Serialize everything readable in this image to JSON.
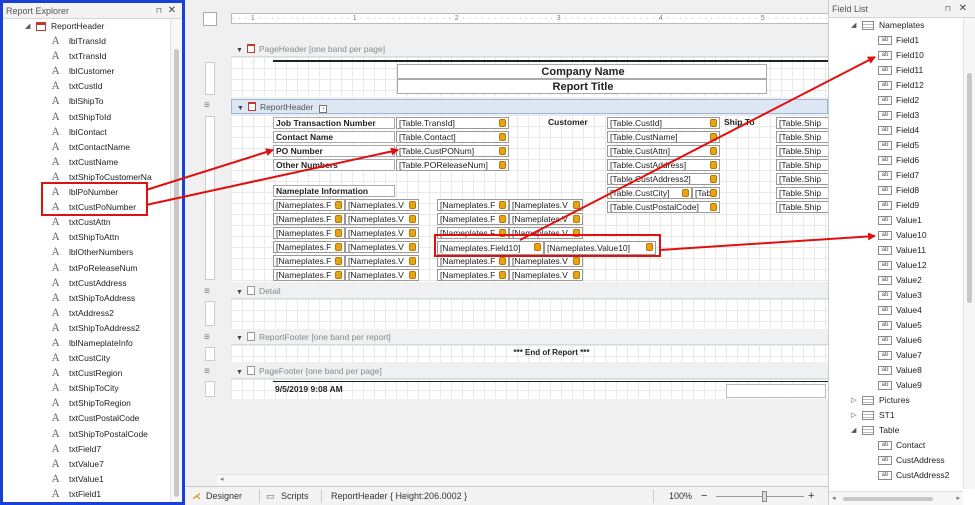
{
  "explorer": {
    "title": "Report Explorer",
    "root_label": "ReportHeader",
    "items": [
      "lblTransId",
      "txtTransId",
      "lblCustomer",
      "txtCustId",
      "lblShipTo",
      "txtShipToId",
      "lblContact",
      "txtContactName",
      "txtCustName",
      "txtShipToCustomerNa",
      "lblPoNumber",
      "txtCustPoNumber",
      "txtCustAttn",
      "txtShipToAttn",
      "lblOtherNumbers",
      "txtPoReleaseNum",
      "txtCustAddress",
      "txtShipToAddress",
      "txtAddress2",
      "txtShipToAddress2",
      "lblNameplateInfo",
      "txtCustCity",
      "txtCustRegion",
      "txtShipToCity",
      "txtShipToRegion",
      "txtCustPostalCode",
      "txtShipToPostalCode",
      "txtField7",
      "txtValue7",
      "txtValue1",
      "txtField1"
    ]
  },
  "designer": {
    "ruler": "· · · 1 · · · · · · · · · · · · · · · 1 · · · · · · · · · · · · · · · 2 · · · · · · · · · · · · · · · 3 · · · · · · · · · · · · · · · 4 · · · · · · · · · · · · · · · 5 · · · · · · · · · · · · · · · 6 · · · · · · · · · · 1",
    "bands": {
      "page_header": "PageHeader [one band per page]",
      "report_header": "ReportHeader",
      "detail": "Detail",
      "report_footer": "ReportFooter [one band per report]",
      "page_footer": "PageFooter [one band per page]"
    },
    "company_name": "Company Name",
    "report_title": "Report Title",
    "labels": {
      "job": "Job Transaction Number",
      "contact": "Contact Name",
      "po": "PO Number",
      "other": "Other Numbers",
      "customer": "Customer",
      "ship_to": "Ship To",
      "nameplate": "Nameplate Information"
    },
    "fields": {
      "trans_id": "[Table.TransId]",
      "contact": "[Table.Contact]",
      "cust_po": "[Table.CustPONum]",
      "po_release": "[Table.POReleaseNum]",
      "cust_id": "[Table.CustId]",
      "cust_name": "[Table.CustName]",
      "cust_attn": "[Table.CustAttn]",
      "cust_address": "[Table.CustAddress]",
      "cust_address2": "[Table.CustAddress2]",
      "cust_city": "[Table.CustCity]",
      "tab_short": "[Tab",
      "cust_postal": "[Table.CustPostalCode]",
      "ship_short": "[Table.Ship"
    },
    "np_field_short": "[Nameplates.F",
    "np_value_short": "[Nameplates.V",
    "np_field10": "[Nameplates.Field10]",
    "np_value10": "[Nameplates.Value10]",
    "end_of_report": "*** End of Report ***",
    "footer_date": "9/5/2019 9:08 AM"
  },
  "fieldlist": {
    "title": "Field List",
    "nameplates": "Nameplates",
    "fields": [
      "Field1",
      "Field10",
      "Field11",
      "Field12",
      "Field2",
      "Field3",
      "Field4",
      "Field5",
      "Field6",
      "Field7",
      "Field8",
      "Field9",
      "Value1",
      "Value10",
      "Value11",
      "Value12",
      "Value2",
      "Value3",
      "Value4",
      "Value5",
      "Value6",
      "Value7",
      "Value8",
      "Value9"
    ],
    "pictures": "Pictures",
    "st1": "ST1",
    "table": "Table",
    "table_fields": [
      "Contact",
      "CustAddress",
      "CustAddress2"
    ]
  },
  "statusbar": {
    "designer": "Designer",
    "scripts": "Scripts",
    "info": "ReportHeader { Height:206.0002 }",
    "zoom": "100%",
    "zoom_level": 1.0,
    "minus": "−",
    "plus": "+"
  }
}
